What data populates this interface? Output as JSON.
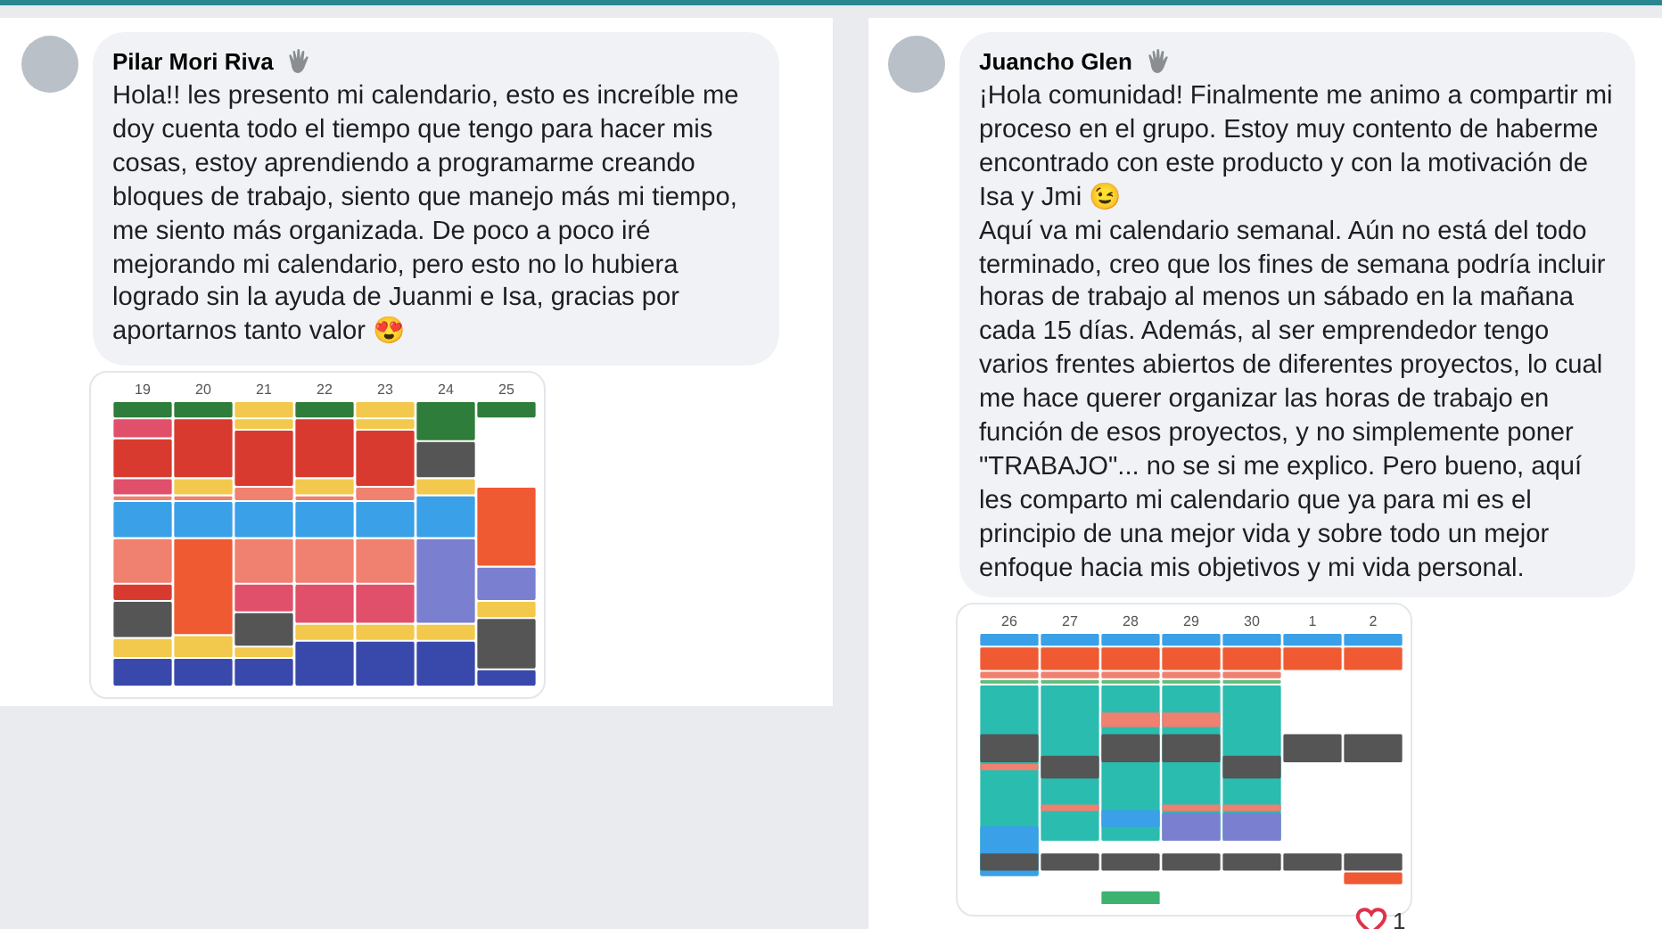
{
  "comments": [
    {
      "author": "Pilar Mori Riva",
      "text": "Hola!! les presento mi calendario, esto es increíble me doy cuenta todo el tiempo que tengo para hacer mis cosas, estoy aprendiendo a programarme creando bloques de trabajo, siento que manejo más mi tiempo, me siento más organizada. De poco a poco iré mejorando mi calendario, pero esto no lo hubiera logrado sin la ayuda de Juanmi e Isa, gracias por aportarnos tanto valor 😍",
      "calendar_days": [
        "19",
        "20",
        "21",
        "22",
        "23",
        "24",
        "25"
      ]
    },
    {
      "author": "Juancho Glen",
      "text": "¡Hola comunidad! Finalmente me animo a compartir mi proceso en el grupo. Estoy muy contento de haberme encontrado con este producto y con la motivación de Isa y Jmi 😉\nAquí va mi calendario semanal. Aún no está del todo terminado, creo que los fines de semana podría incluir horas de trabajo al menos un sábado en la mañana cada 15 días. Además, al ser emprendedor tengo varios frentes abiertos de diferentes proyectos, lo cual me hace querer organizar las horas de trabajo en función de esos proyectos, y no simplemente poner \"TRABAJO\"... no se si me explico. Pero bueno, aquí les comparto mi calendario que ya para mi es el principio de una mejor vida y sobre todo un mejor enfoque hacia mis objetivos y mi vida personal.",
      "calendar_days": [
        "26",
        "27",
        "28",
        "29",
        "30",
        "1",
        "2"
      ],
      "reaction_count": "1"
    }
  ]
}
